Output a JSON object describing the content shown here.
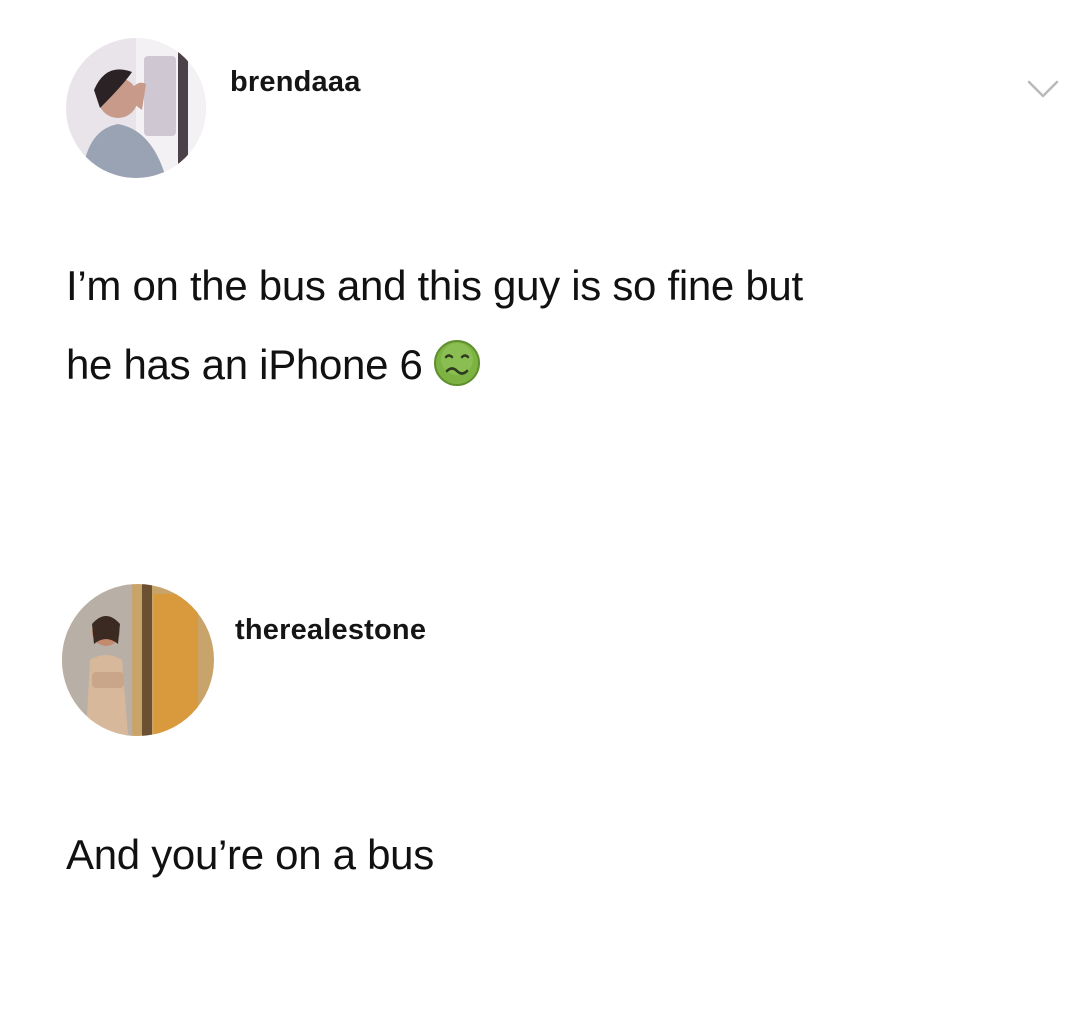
{
  "posts": [
    {
      "username": "brendaaa",
      "avatar_icon": "profile-photo-avatar",
      "text_line1": "I’m on the bus and this guy is so fine but",
      "text_line2": "he has an iPhone 6",
      "emoji": "nauseated-face-emoji"
    },
    {
      "username": "therealestone",
      "avatar_icon": "profile-photo-avatar",
      "text": "And you’re on a bus"
    }
  ],
  "menu_icon": "chevron-down-icon",
  "colors": {
    "background": "#ffffff",
    "text": "#111111",
    "chevron": "#b9b9b9",
    "emoji_green": "#7cb342"
  }
}
